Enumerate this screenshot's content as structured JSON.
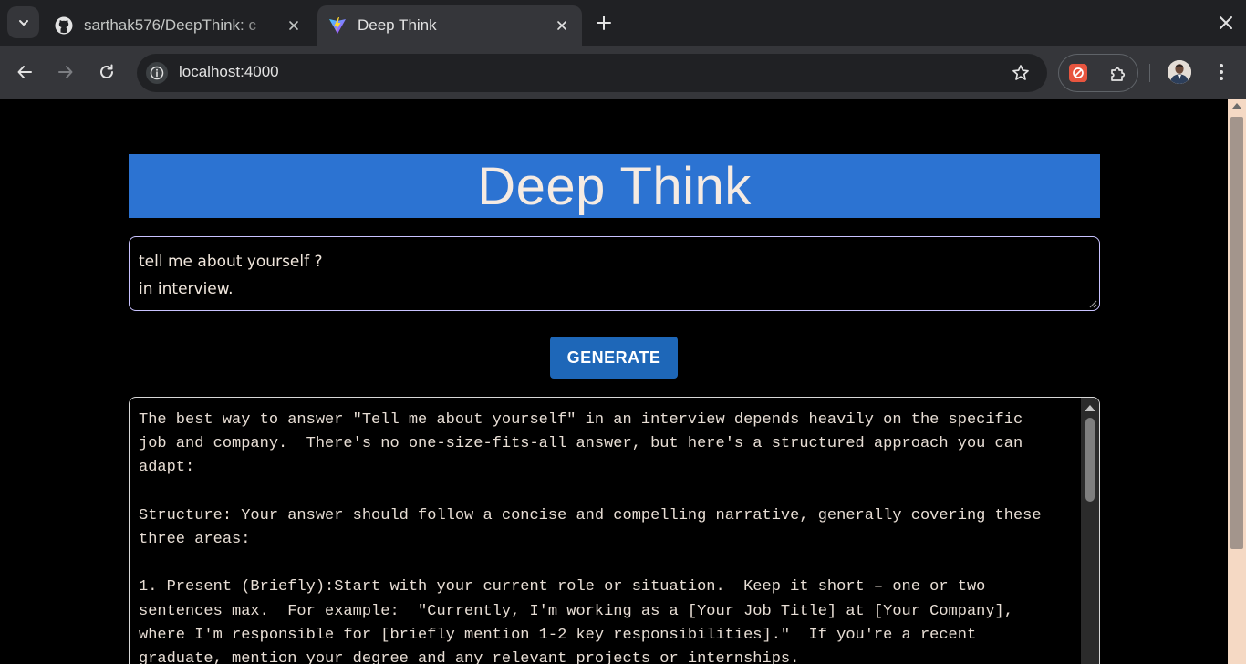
{
  "browser": {
    "tabs": [
      {
        "title": "sarthak576/DeepThink: c",
        "favicon": "github-icon",
        "active": false
      },
      {
        "title": "Deep Think",
        "favicon": "vite-icon",
        "active": true
      }
    ],
    "url": "localhost:4000"
  },
  "page": {
    "title": "Deep Think",
    "prompt_lines": [
      "tell me about yourself ?",
      "in interview."
    ],
    "generate_label": "GENERATE",
    "output_lines": [
      "The best way to answer \"Tell me about yourself\" in an interview depends heavily on the specific",
      "job and company.  There's no one-size-fits-all answer, but here's a structured approach you can",
      "adapt:",
      "",
      "Structure: Your answer should follow a concise and compelling narrative, generally covering these",
      "three areas:",
      "",
      "1. Present (Briefly):Start with your current role or situation.  Keep it short – one or two",
      "sentences max.  For example:  \"Currently, I'm working as a [Your Job Title] at [Your Company],",
      "where I'm responsible for [briefly mention 1-2 key responsibilities].\"  If you're a recent",
      "graduate, mention your degree and any relevant projects or internships."
    ]
  },
  "colors": {
    "banner": "#2c73d2",
    "button": "#1e67b8",
    "page_background": "#000000",
    "prompt_border": "#c9c3ff"
  }
}
